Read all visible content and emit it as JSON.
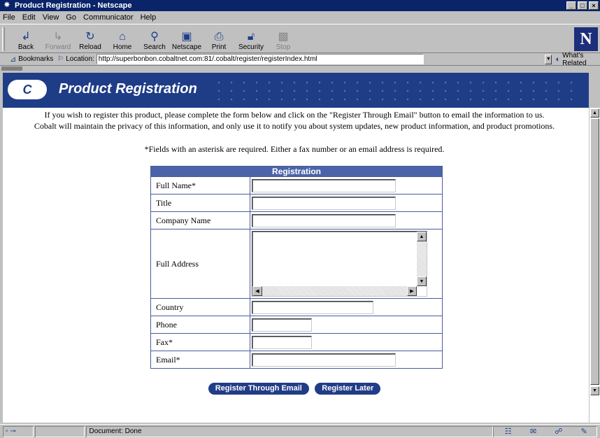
{
  "window": {
    "title": "Product Registration - Netscape",
    "controls": [
      "_",
      "□",
      "×"
    ]
  },
  "menu": [
    "File",
    "Edit",
    "View",
    "Go",
    "Communicator",
    "Help"
  ],
  "toolbar": {
    "buttons": [
      {
        "label": "Back",
        "icon": "back-arrow-icon",
        "enabled": true
      },
      {
        "label": "Forward",
        "icon": "forward-arrow-icon",
        "enabled": false
      },
      {
        "label": "Reload",
        "icon": "reload-icon",
        "enabled": true
      },
      {
        "label": "Home",
        "icon": "home-icon",
        "enabled": true
      },
      {
        "label": "Search",
        "icon": "search-icon",
        "enabled": true
      },
      {
        "label": "Netscape",
        "icon": "netscape-icon",
        "enabled": true
      },
      {
        "label": "Print",
        "icon": "print-icon",
        "enabled": true
      },
      {
        "label": "Security",
        "icon": "lock-icon",
        "enabled": true
      },
      {
        "label": "Stop",
        "icon": "stop-icon",
        "enabled": false
      }
    ],
    "logo": "N"
  },
  "location": {
    "bookmarks_label": "Bookmarks",
    "location_label": "Location:",
    "url": "http://superbonbon.cobaltnet.com:81/.cobalt/register/registerIndex.html",
    "whats_related": "What's Related"
  },
  "banner": {
    "logo_text": "C",
    "title": "Product Registration"
  },
  "page": {
    "intro_line1": "If you wish to register this product, please complete the form below and click on the \"Register Through Email\" button to email the information to us.",
    "intro_line2": "Cobalt will maintain the privacy of this information, and only use it to notify you about system updates, new product information, and product promotions.",
    "note": "*Fields with an asterisk are required. Either a fax number or an email address is required."
  },
  "form": {
    "header": "Registration",
    "fields": [
      {
        "label": "Full Name*",
        "value": ""
      },
      {
        "label": "Title",
        "value": ""
      },
      {
        "label": "Company Name",
        "value": ""
      },
      {
        "label": "Full Address",
        "value": ""
      },
      {
        "label": "Country",
        "value": ""
      },
      {
        "label": "Phone",
        "value": ""
      },
      {
        "label": "Fax*",
        "value": ""
      },
      {
        "label": "Email*",
        "value": ""
      }
    ],
    "buttons": {
      "register_email": "Register Through Email",
      "register_later": "Register Later"
    }
  },
  "status": {
    "message": "Document: Done"
  }
}
